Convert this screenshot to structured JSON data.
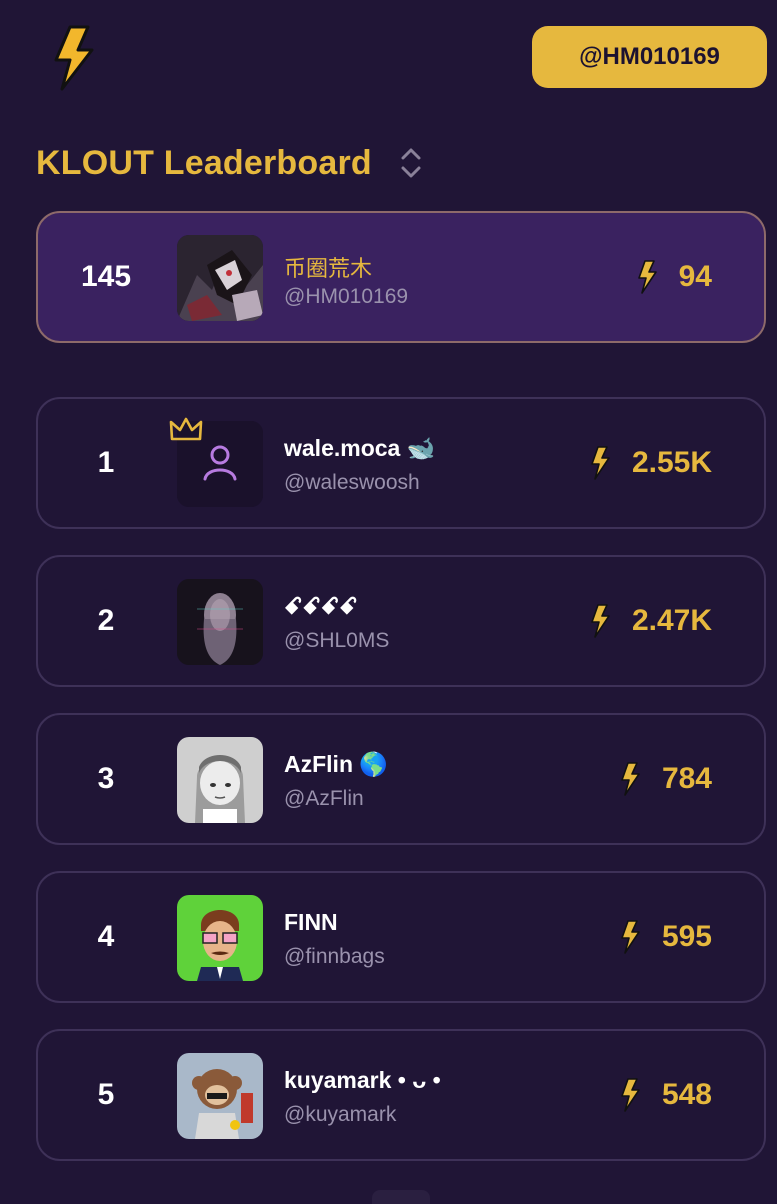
{
  "header": {
    "logo_icon": "lightning-bolt-icon",
    "user_handle_button": "@HM010169"
  },
  "leaderboard": {
    "title": "KLOUT Leaderboard",
    "sort_icon": "chevron-up-down-icon"
  },
  "current_user": {
    "rank": "145",
    "name": "币圈荒木",
    "handle": "@HM010169",
    "score": "94"
  },
  "entries": [
    {
      "rank": "1",
      "name": "wale.moca 🐋",
      "handle": "@waleswoosh",
      "score": "2.55K",
      "avatar": "default-user-icon",
      "crown": true
    },
    {
      "rank": "2",
      "name": "ꗃꗃꗃꗃ",
      "handle": "@SHL0MS",
      "score": "2.47K",
      "avatar": "glitch-portrait"
    },
    {
      "rank": "3",
      "name": "AzFlin 🌎",
      "handle": "@AzFlin",
      "score": "784",
      "avatar": "grayscale-cartoon"
    },
    {
      "rank": "4",
      "name": "FINN",
      "handle": "@finnbags",
      "score": "595",
      "avatar": "green-cartoon-man"
    },
    {
      "rank": "5",
      "name": "kuyamark • ᴗ •",
      "handle": "@kuyamark",
      "score": "548",
      "avatar": "monkey-cartoon"
    }
  ],
  "colors": {
    "background": "#201536",
    "accent": "#e6b83e",
    "highlight_row": "#3a2260",
    "muted_text": "#9a92ad"
  }
}
